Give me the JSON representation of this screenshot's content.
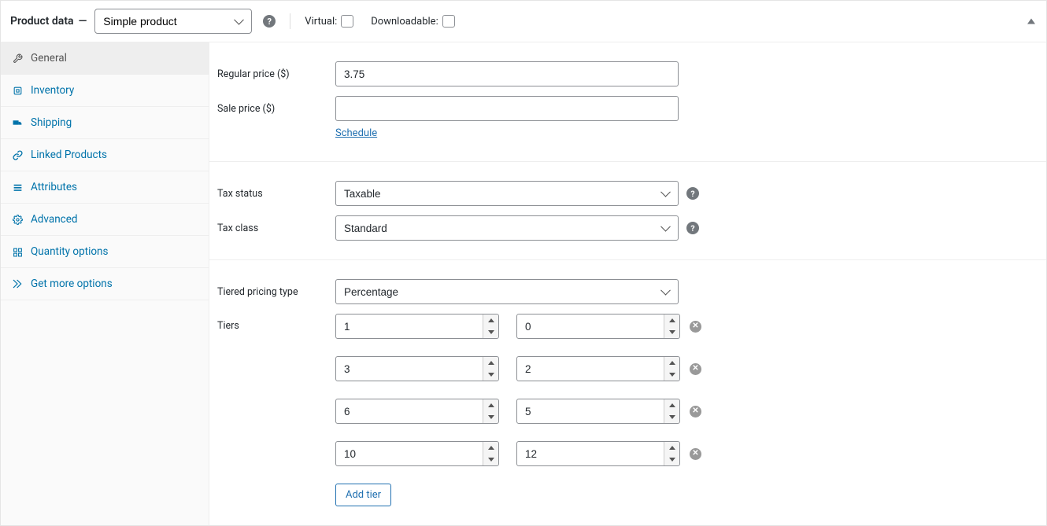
{
  "header": {
    "title_prefix": "Product data",
    "title_sep": "—",
    "product_type": "Simple product",
    "virtual_label": "Virtual:",
    "downloadable_label": "Downloadable:"
  },
  "tabs": [
    {
      "id": "general",
      "label": "General",
      "active": true
    },
    {
      "id": "inventory",
      "label": "Inventory",
      "active": false
    },
    {
      "id": "shipping",
      "label": "Shipping",
      "active": false
    },
    {
      "id": "linked",
      "label": "Linked Products",
      "active": false
    },
    {
      "id": "attributes",
      "label": "Attributes",
      "active": false
    },
    {
      "id": "advanced",
      "label": "Advanced",
      "active": false
    },
    {
      "id": "quantity",
      "label": "Quantity options",
      "active": false
    },
    {
      "id": "more",
      "label": "Get more options",
      "active": false
    }
  ],
  "pricing": {
    "regular_label": "Regular price ($)",
    "regular_value": "3.75",
    "sale_label": "Sale price ($)",
    "sale_value": "",
    "schedule_link": "Schedule"
  },
  "tax": {
    "status_label": "Tax status",
    "status_value": "Taxable",
    "class_label": "Tax class",
    "class_value": "Standard"
  },
  "tiered": {
    "type_label": "Tiered pricing type",
    "type_value": "Percentage",
    "tiers_label": "Tiers",
    "tiers": [
      {
        "qty": "1",
        "val": "0"
      },
      {
        "qty": "3",
        "val": "2"
      },
      {
        "qty": "6",
        "val": "5"
      },
      {
        "qty": "10",
        "val": "12"
      }
    ],
    "add_tier_label": "Add tier"
  }
}
